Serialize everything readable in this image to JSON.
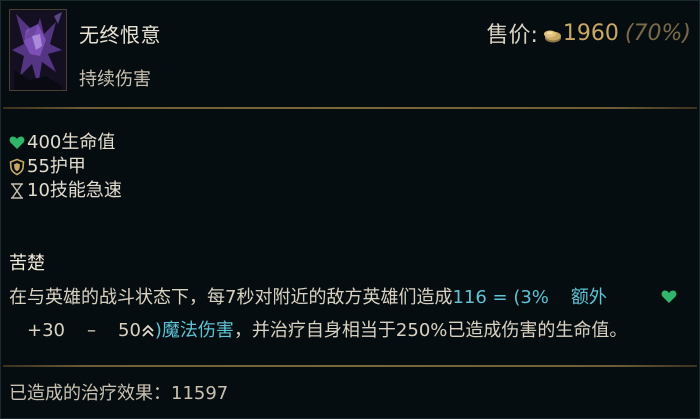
{
  "item": {
    "name": "无终恨意",
    "tag": "持续伤害",
    "icon": "item-portrait-icon"
  },
  "price": {
    "label": "售价:",
    "value": "1960",
    "discount": "(70%)",
    "icon": "gold-coin-icon"
  },
  "stats": [
    {
      "text": "400生命值",
      "icon": "heart-icon",
      "color": "#2fb66a"
    },
    {
      "text": "55护甲",
      "icon": "armor-shield-icon",
      "color": "#c9a864"
    },
    {
      "text": "10技能急速",
      "icon": "hourglass-icon",
      "color": "#c9c2b2"
    }
  ],
  "passive": {
    "name": "苦楚",
    "line1_text": "在与英雄的战斗状态下，每7秒对附近的敌方英雄们造成",
    "damage_formula": "116 = (3%",
    "extra_label": "额外",
    "heart_icon": "heart-icon",
    "scaling_a": "+30",
    "dash": "–",
    "scaling_b": "50",
    "level_icon": "level-chevron-icon",
    "magic_damage": ")魔法伤害",
    "line2_rest": "，并治疗自身相当于250%已造成伤害的生命值。"
  },
  "footer": {
    "text": "已造成的治疗效果：11597"
  },
  "colors": {
    "background": "#060d10",
    "gold": "#c9a864",
    "teal": "#5fc3d6",
    "health_green": "#2fb66a"
  }
}
